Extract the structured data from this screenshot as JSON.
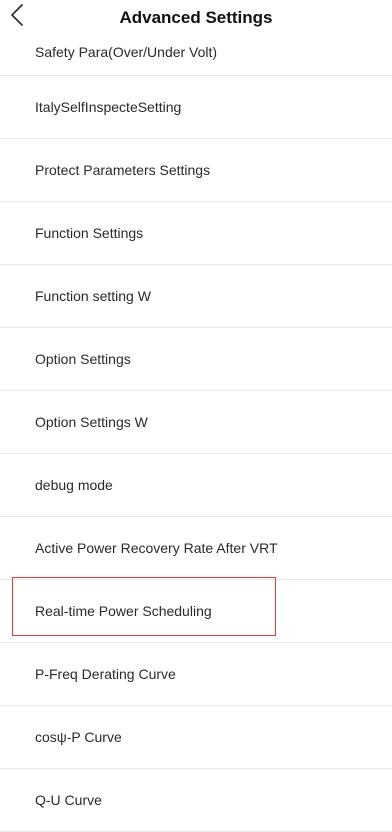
{
  "header": {
    "title": "Advanced Settings",
    "back_icon": "chevron-left-icon"
  },
  "menu": {
    "items": [
      {
        "label": "Safety Para(Over/Under Volt)"
      },
      {
        "label": "ItalySelfInspecteSetting"
      },
      {
        "label": "Protect Parameters Settings"
      },
      {
        "label": "Function Settings"
      },
      {
        "label": "Function setting W"
      },
      {
        "label": "Option Settings"
      },
      {
        "label": "Option Settings W"
      },
      {
        "label": "debug mode"
      },
      {
        "label": "Active Power Recovery Rate After VRT"
      },
      {
        "label": "Real-time Power Scheduling"
      },
      {
        "label": "P-Freq Derating Curve"
      },
      {
        "label": "cosψ-P Curve"
      },
      {
        "label": "Q-U Curve"
      }
    ]
  },
  "highlight": {
    "target": "Real-time Power Scheduling",
    "color": "#e23b3b"
  }
}
